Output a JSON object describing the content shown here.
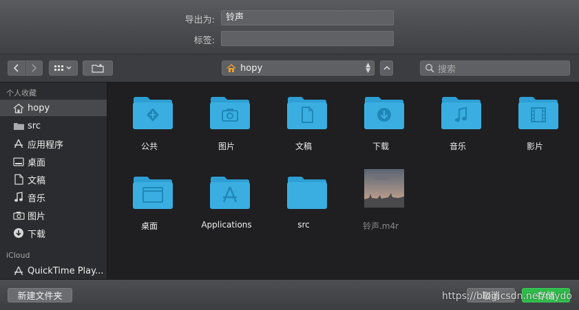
{
  "form": {
    "save_as_label": "导出为:",
    "save_as_value": "铃声",
    "tags_label": "标签:",
    "tags_value": ""
  },
  "toolbar": {
    "back_icon": "chevron-left-icon",
    "forward_icon": "chevron-right-icon",
    "view_icon": "grid-view-icon",
    "group_icon": "new-folder-icon",
    "location": "hopy",
    "location_icon": "home-icon",
    "expand_icon": "chevron-up-icon",
    "search_placeholder": "搜索"
  },
  "sidebar": {
    "favorites_header": "个人收藏",
    "items": [
      {
        "label": "hopy",
        "icon": "home-icon",
        "selected": true
      },
      {
        "label": "src",
        "icon": "folder-icon"
      },
      {
        "label": "应用程序",
        "icon": "applications-icon"
      },
      {
        "label": "桌面",
        "icon": "desktop-icon"
      },
      {
        "label": "文稿",
        "icon": "document-icon"
      },
      {
        "label": "音乐",
        "icon": "music-icon"
      },
      {
        "label": "图片",
        "icon": "camera-icon"
      },
      {
        "label": "下载",
        "icon": "download-icon"
      }
    ],
    "icloud_header": "iCloud",
    "icloud_items": [
      {
        "label": "QuickTime Play...",
        "icon": "applications-icon"
      }
    ]
  },
  "files": [
    {
      "name": "公共",
      "icon": "public-folder-icon"
    },
    {
      "name": "图片",
      "icon": "pictures-folder-icon"
    },
    {
      "name": "文稿",
      "icon": "documents-folder-icon"
    },
    {
      "name": "下载",
      "icon": "downloads-folder-icon"
    },
    {
      "name": "音乐",
      "icon": "music-folder-icon"
    },
    {
      "name": "影片",
      "icon": "movies-folder-icon"
    },
    {
      "name": "桌面",
      "icon": "desktop-folder-icon"
    },
    {
      "name": "Applications",
      "icon": "applications-folder-icon"
    },
    {
      "name": "src",
      "icon": "folder-icon"
    },
    {
      "name": "铃声.m4r",
      "icon": "image-thumbnail-icon",
      "dimmed": true
    }
  ],
  "bottom": {
    "new_folder_label": "新建文件夹",
    "cancel_label": "取消",
    "save_label": "存储",
    "watermark": "https://blog.csdn.net/mydo"
  },
  "colors": {
    "folder_blue": "#3aaee0",
    "save_green": "#2fbb4a"
  }
}
